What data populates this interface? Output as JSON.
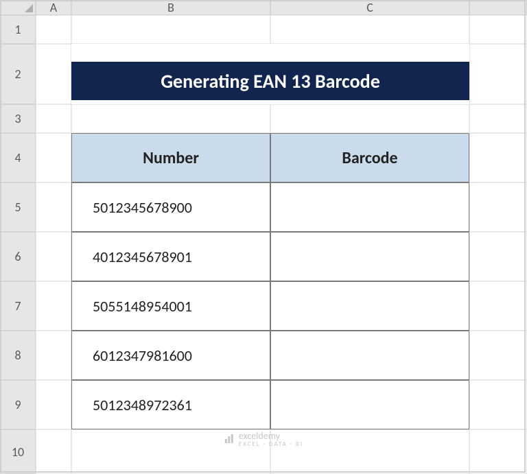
{
  "columns": [
    "A",
    "B",
    "C"
  ],
  "rows": [
    "1",
    "2",
    "3",
    "4",
    "5",
    "6",
    "7",
    "8",
    "9",
    "10"
  ],
  "title": "Generating EAN 13 Barcode",
  "table": {
    "headers": [
      "Number",
      "Barcode"
    ],
    "data": [
      {
        "number": "5012345678900",
        "barcode": ""
      },
      {
        "number": "4012345678901",
        "barcode": ""
      },
      {
        "number": "5055148954001",
        "barcode": ""
      },
      {
        "number": "6012347981600",
        "barcode": ""
      },
      {
        "number": "5012348972361",
        "barcode": ""
      }
    ]
  },
  "watermark": {
    "brand": "exceldemy",
    "tagline": "EXCEL · DATA · BI"
  }
}
